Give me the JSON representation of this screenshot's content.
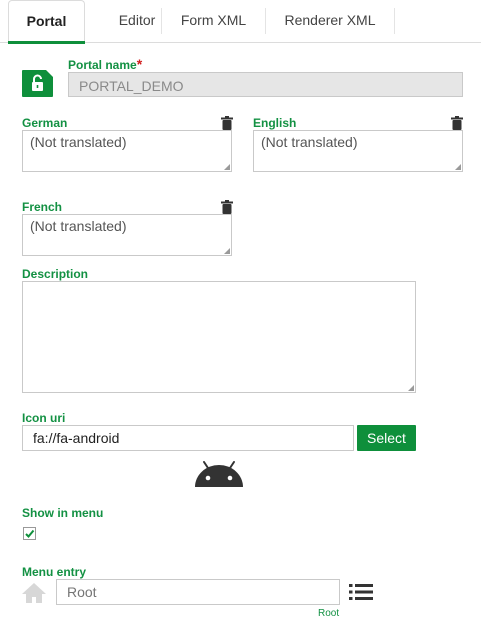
{
  "tabs": [
    {
      "label": "Portal",
      "active": true
    },
    {
      "label": "Editor",
      "active": false
    },
    {
      "label": "Form XML",
      "active": false
    },
    {
      "label": "Renderer XML",
      "active": false
    }
  ],
  "portal_name": {
    "label": "Portal name",
    "required_mark": "*",
    "value": "PORTAL_DEMO"
  },
  "translations": [
    {
      "language": "German",
      "value": "(Not translated)"
    },
    {
      "language": "English",
      "value": "(Not translated)"
    },
    {
      "language": "French",
      "value": "(Not translated)"
    }
  ],
  "description": {
    "label": "Description",
    "value": ""
  },
  "icon_uri": {
    "label": "Icon uri",
    "value": "fa://fa-android",
    "select_label": "Select",
    "preview_icon": "android-icon"
  },
  "show_in_menu": {
    "label": "Show in menu",
    "checked": true
  },
  "menu_entry": {
    "label": "Menu entry",
    "placeholder": "Root",
    "path_label": "Root"
  },
  "colors": {
    "accent": "#0e8f3b",
    "label": "#139143",
    "required": "#d01e1e"
  }
}
